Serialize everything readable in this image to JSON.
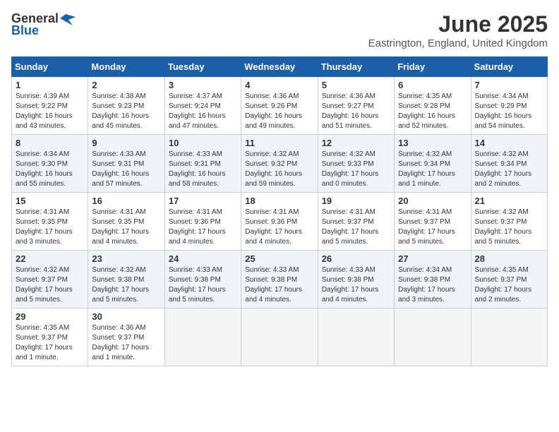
{
  "header": {
    "logo_general": "General",
    "logo_blue": "Blue",
    "month": "June 2025",
    "location": "Eastrington, England, United Kingdom"
  },
  "weekdays": [
    "Sunday",
    "Monday",
    "Tuesday",
    "Wednesday",
    "Thursday",
    "Friday",
    "Saturday"
  ],
  "weeks": [
    [
      {
        "day": "1",
        "info": "Sunrise: 4:39 AM\nSunset: 9:22 PM\nDaylight: 16 hours and 43 minutes."
      },
      {
        "day": "2",
        "info": "Sunrise: 4:38 AM\nSunset: 9:23 PM\nDaylight: 16 hours and 45 minutes."
      },
      {
        "day": "3",
        "info": "Sunrise: 4:37 AM\nSunset: 9:24 PM\nDaylight: 16 hours and 47 minutes."
      },
      {
        "day": "4",
        "info": "Sunrise: 4:36 AM\nSunset: 9:26 PM\nDaylight: 16 hours and 49 minutes."
      },
      {
        "day": "5",
        "info": "Sunrise: 4:36 AM\nSunset: 9:27 PM\nDaylight: 16 hours and 51 minutes."
      },
      {
        "day": "6",
        "info": "Sunrise: 4:35 AM\nSunset: 9:28 PM\nDaylight: 16 hours and 52 minutes."
      },
      {
        "day": "7",
        "info": "Sunrise: 4:34 AM\nSunset: 9:29 PM\nDaylight: 16 hours and 54 minutes."
      }
    ],
    [
      {
        "day": "8",
        "info": "Sunrise: 4:34 AM\nSunset: 9:30 PM\nDaylight: 16 hours and 55 minutes."
      },
      {
        "day": "9",
        "info": "Sunrise: 4:33 AM\nSunset: 9:31 PM\nDaylight: 16 hours and 57 minutes."
      },
      {
        "day": "10",
        "info": "Sunrise: 4:33 AM\nSunset: 9:31 PM\nDaylight: 16 hours and 58 minutes."
      },
      {
        "day": "11",
        "info": "Sunrise: 4:32 AM\nSunset: 9:32 PM\nDaylight: 16 hours and 59 minutes."
      },
      {
        "day": "12",
        "info": "Sunrise: 4:32 AM\nSunset: 9:33 PM\nDaylight: 17 hours and 0 minutes."
      },
      {
        "day": "13",
        "info": "Sunrise: 4:32 AM\nSunset: 9:34 PM\nDaylight: 17 hours and 1 minute."
      },
      {
        "day": "14",
        "info": "Sunrise: 4:32 AM\nSunset: 9:34 PM\nDaylight: 17 hours and 2 minutes."
      }
    ],
    [
      {
        "day": "15",
        "info": "Sunrise: 4:31 AM\nSunset: 9:35 PM\nDaylight: 17 hours and 3 minutes."
      },
      {
        "day": "16",
        "info": "Sunrise: 4:31 AM\nSunset: 9:35 PM\nDaylight: 17 hours and 4 minutes."
      },
      {
        "day": "17",
        "info": "Sunrise: 4:31 AM\nSunset: 9:36 PM\nDaylight: 17 hours and 4 minutes."
      },
      {
        "day": "18",
        "info": "Sunrise: 4:31 AM\nSunset: 9:36 PM\nDaylight: 17 hours and 4 minutes."
      },
      {
        "day": "19",
        "info": "Sunrise: 4:31 AM\nSunset: 9:37 PM\nDaylight: 17 hours and 5 minutes."
      },
      {
        "day": "20",
        "info": "Sunrise: 4:31 AM\nSunset: 9:37 PM\nDaylight: 17 hours and 5 minutes."
      },
      {
        "day": "21",
        "info": "Sunrise: 4:32 AM\nSunset: 9:37 PM\nDaylight: 17 hours and 5 minutes."
      }
    ],
    [
      {
        "day": "22",
        "info": "Sunrise: 4:32 AM\nSunset: 9:37 PM\nDaylight: 17 hours and 5 minutes."
      },
      {
        "day": "23",
        "info": "Sunrise: 4:32 AM\nSunset: 9:38 PM\nDaylight: 17 hours and 5 minutes."
      },
      {
        "day": "24",
        "info": "Sunrise: 4:33 AM\nSunset: 9:38 PM\nDaylight: 17 hours and 5 minutes."
      },
      {
        "day": "25",
        "info": "Sunrise: 4:33 AM\nSunset: 9:38 PM\nDaylight: 17 hours and 4 minutes."
      },
      {
        "day": "26",
        "info": "Sunrise: 4:33 AM\nSunset: 9:38 PM\nDaylight: 17 hours and 4 minutes."
      },
      {
        "day": "27",
        "info": "Sunrise: 4:34 AM\nSunset: 9:38 PM\nDaylight: 17 hours and 3 minutes."
      },
      {
        "day": "28",
        "info": "Sunrise: 4:35 AM\nSunset: 9:37 PM\nDaylight: 17 hours and 2 minutes."
      }
    ],
    [
      {
        "day": "29",
        "info": "Sunrise: 4:35 AM\nSunset: 9:37 PM\nDaylight: 17 hours and 1 minute."
      },
      {
        "day": "30",
        "info": "Sunrise: 4:36 AM\nSunset: 9:37 PM\nDaylight: 17 hours and 1 minute."
      },
      {
        "day": "",
        "info": ""
      },
      {
        "day": "",
        "info": ""
      },
      {
        "day": "",
        "info": ""
      },
      {
        "day": "",
        "info": ""
      },
      {
        "day": "",
        "info": ""
      }
    ]
  ]
}
